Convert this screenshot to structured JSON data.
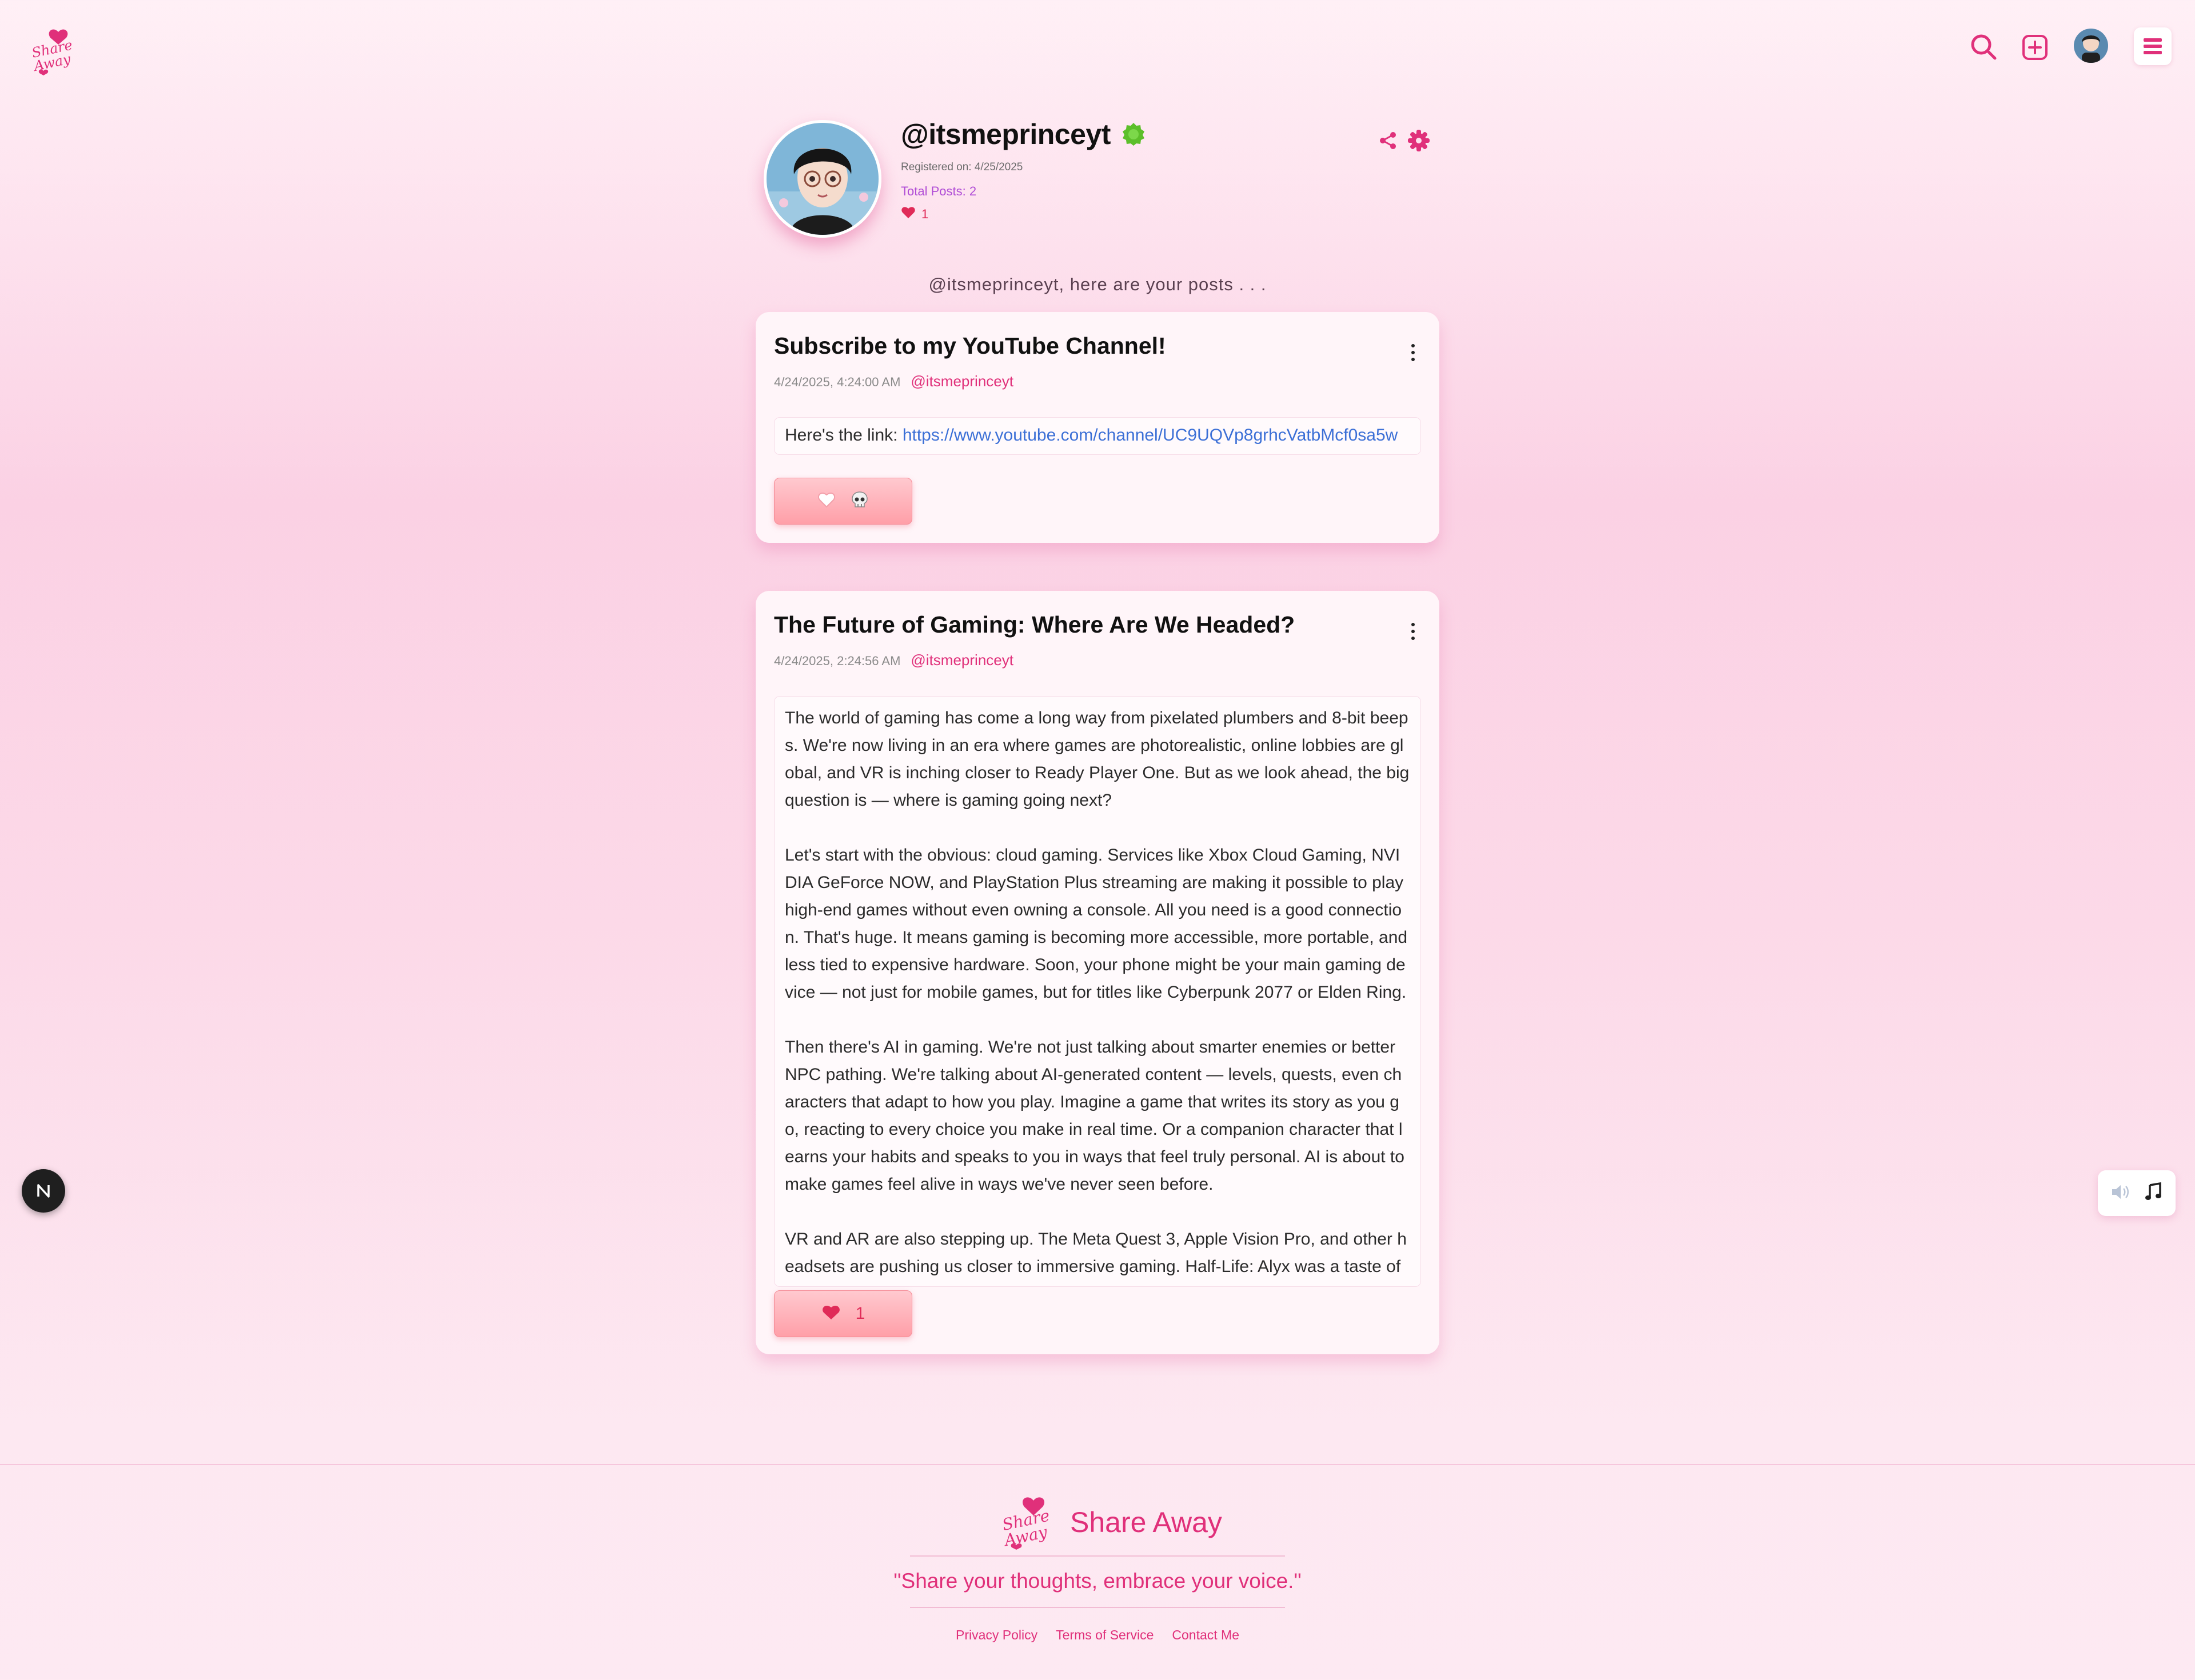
{
  "header": {
    "logo_text": "Share Away",
    "icons": [
      "search-icon",
      "create-post-icon",
      "avatar",
      "hamburger-menu-icon"
    ]
  },
  "profile": {
    "username": "@itsmeprinceyt",
    "registered": "Registered on: 4/25/2025",
    "total_posts": "Total Posts: 2",
    "likes": "1",
    "icons": [
      "verified-badge-icon",
      "share-icon",
      "settings-gear-icon"
    ]
  },
  "posts_intro": "@itsmeprinceyt, here are your posts . . .",
  "posts": [
    {
      "title": "Subscribe to my YouTube Channel!",
      "date": "4/24/2025, 4:24:00 AM",
      "author": "@itsmeprinceyt",
      "body_prefix": "Here's the link: ",
      "link": "https://www.youtube.com/channel/UC9UQVp8grhcVatbMcf0sa5w",
      "reactions": [
        "heart-outline-icon",
        "skull-icon"
      ]
    },
    {
      "title": "The Future of Gaming: Where Are We Headed?",
      "date": "4/24/2025, 2:24:56 AM",
      "author": "@itsmeprinceyt",
      "paragraphs": [
        "The world of gaming has come a long way from pixelated plumbers and 8-bit beeps. We're now living in an era where games are photorealistic, online lobbies are global, and VR is inching closer to Ready Player One. But as we look ahead, the big question is — where is gaming going next?",
        "Let's start with the obvious: cloud gaming. Services like Xbox Cloud Gaming, NVIDIA GeForce NOW, and PlayStation Plus streaming are making it possible to play high-end games without even owning a console. All you need is a good connection. That's huge. It means gaming is becoming more accessible, more portable, and less tied to expensive hardware. Soon, your phone might be your main gaming device — not just for mobile games, but for titles like Cyberpunk 2077 or Elden Ring.",
        "Then there's AI in gaming. We're not just talking about smarter enemies or better NPC pathing. We're talking about AI-generated content — levels, quests, even characters that adapt to how you play. Imagine a game that writes its story as you go, reacting to every choice you make in real time. Or a companion character that learns your habits and speaks to you in ways that feel truly personal. AI is about to make games feel alive in ways we've never seen before.",
        "VR and AR are also stepping up. The Meta Quest 3, Apple Vision Pro, and other headsets are pushing us closer to immersive gaming. Half-Life: Alyx was a taste of"
      ],
      "likes": "1"
    }
  ],
  "widgets": {
    "dev_badge": "N",
    "music_icons": [
      "speaker-icon",
      "music-note-icon"
    ]
  },
  "footer": {
    "brand": "Share Away",
    "tagline": "\"Share your thoughts, embrace your voice.\"",
    "links": [
      "Privacy Policy",
      "Terms of Service",
      "Contact Me"
    ]
  },
  "colors": {
    "accent": "#e0307a",
    "link": "#3b6fd6",
    "heart": "#e02b58",
    "verified": "#5cbf2a",
    "purple": "#b04dd6"
  }
}
